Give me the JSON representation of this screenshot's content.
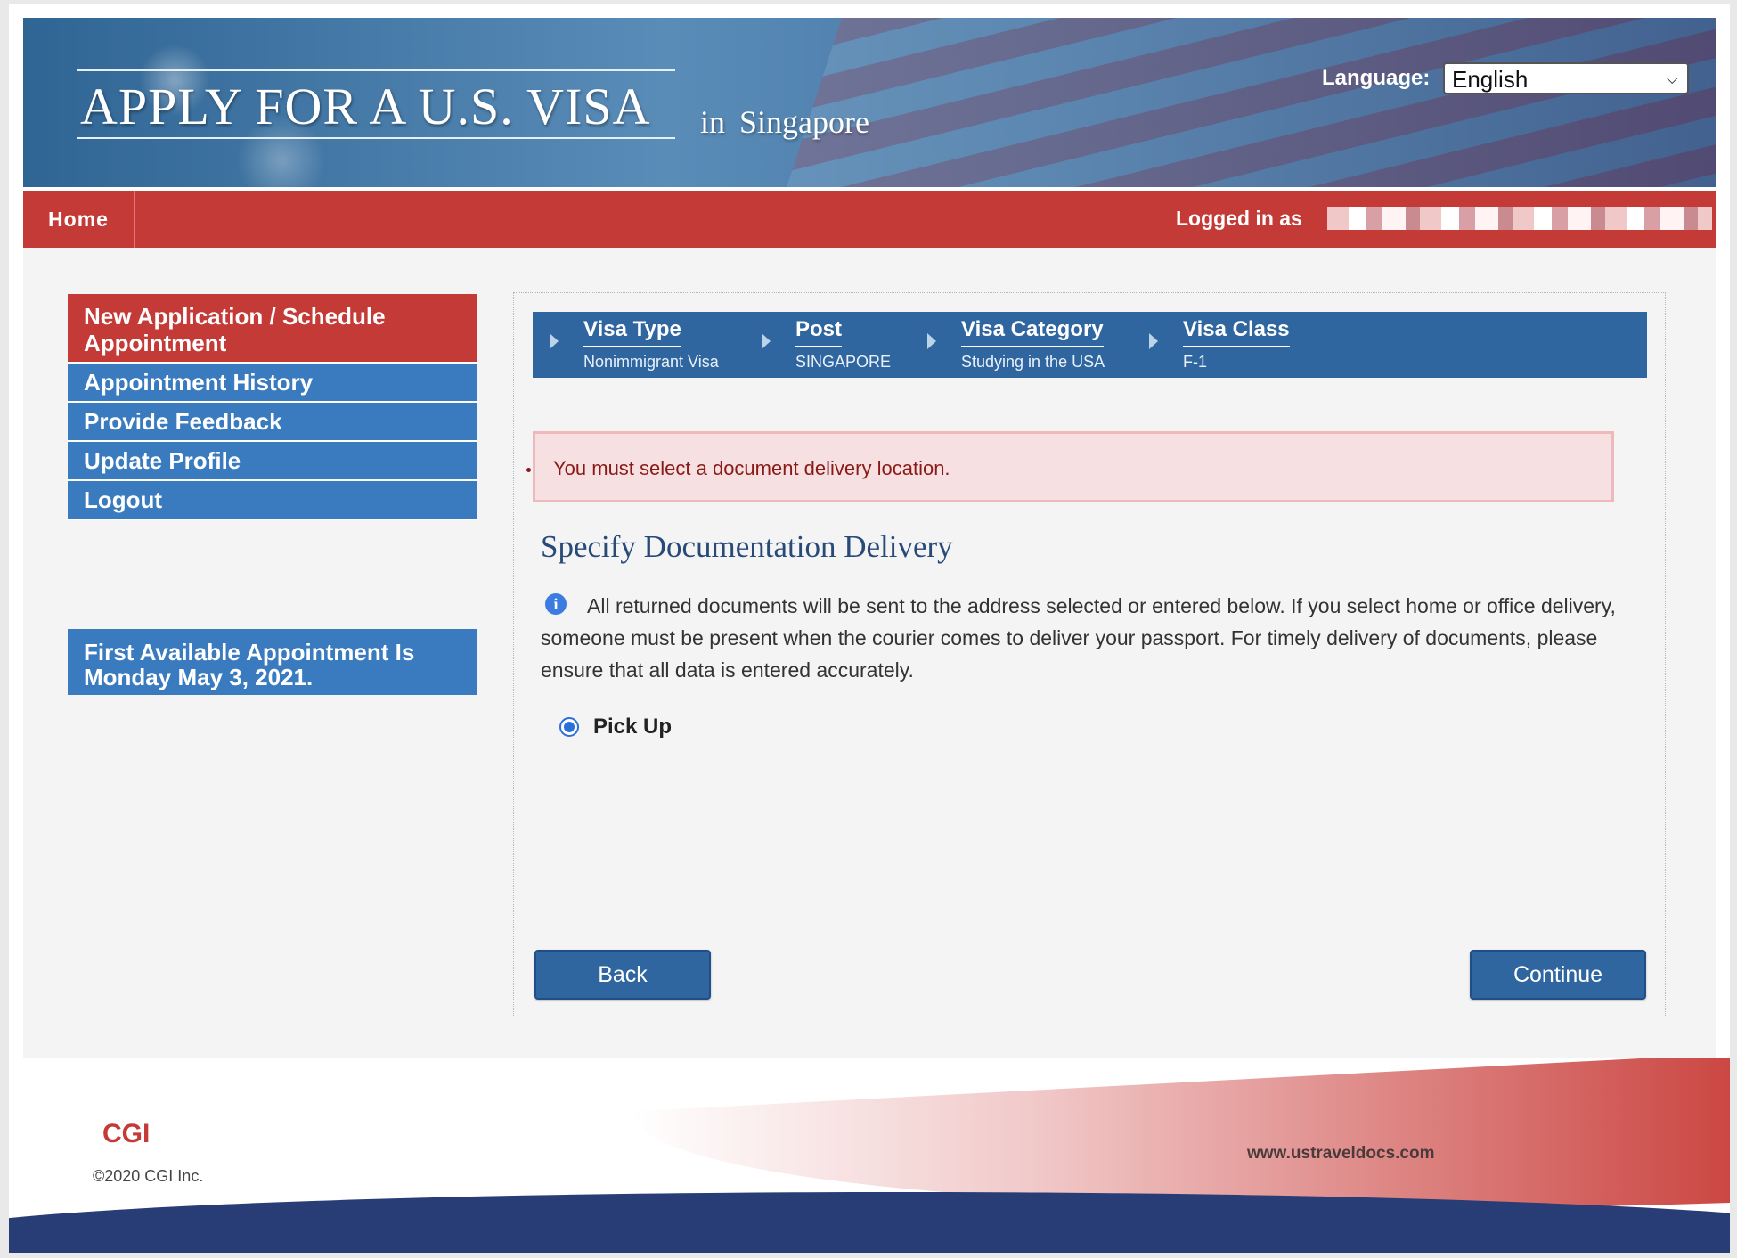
{
  "header": {
    "title": "APPLY FOR A U.S. VISA",
    "in_word": "in",
    "country": "Singapore",
    "language_label": "Language:",
    "language_selected": "English"
  },
  "navbar": {
    "home_label": "Home",
    "logged_in_label": "Logged in as"
  },
  "sidebar": {
    "items": [
      {
        "label": "New Application / Schedule Appointment",
        "active": true
      },
      {
        "label": "Appointment History"
      },
      {
        "label": "Provide Feedback"
      },
      {
        "label": "Update Profile"
      },
      {
        "label": "Logout"
      }
    ],
    "first_available": "First Available Appointment Is Monday May 3, 2021."
  },
  "steps": [
    {
      "label": "Visa Type",
      "value": "Nonimmigrant Visa"
    },
    {
      "label": "Post",
      "value": "SINGAPORE"
    },
    {
      "label": "Visa Category",
      "value": "Studying in the USA"
    },
    {
      "label": "Visa Class",
      "value": "F-1"
    }
  ],
  "error": {
    "message": "You must select a document delivery location."
  },
  "main": {
    "section_title": "Specify Documentation Delivery",
    "info_text": "All returned documents will be sent to the address selected or entered below. If you select home or office delivery, someone must be present when the courier comes to deliver your passport. For timely delivery of documents, please ensure that all data is entered accurately.",
    "delivery_option": "Pick Up"
  },
  "buttons": {
    "back": "Back",
    "continue": "Continue"
  },
  "footer": {
    "logo": "CGI",
    "copyright": "©2020 CGI Inc.",
    "url": "www.ustraveldocs.com"
  },
  "colors": {
    "nav_red": "#c43a37",
    "primary_blue": "#2f66a0",
    "sidebar_blue": "#3a7bbf",
    "error_bg": "#f6e0e1"
  },
  "icons": [
    "info-icon",
    "chevron-down-icon",
    "step-arrow-icon",
    "radio-selected"
  ]
}
